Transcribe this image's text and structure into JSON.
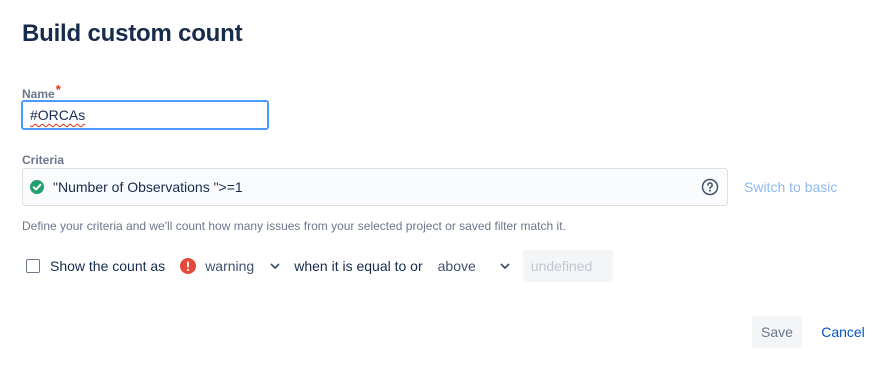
{
  "dialog": {
    "title": "Build custom count"
  },
  "name_field": {
    "label": "Name",
    "required_mark": "*",
    "value": "#ORCAs"
  },
  "criteria_field": {
    "label": "Criteria",
    "value": "\"Number of Observations \">=1",
    "status_icon": "check-circle-icon",
    "help_icon": "question-circle-icon",
    "switch_label": "Switch to basic",
    "helper_text": "Define your criteria and we'll count how many issues from your selected project or saved filter match it."
  },
  "count_row": {
    "checkbox_label": "Show the count as",
    "checked": false,
    "status_value": "warning",
    "connector_text": "when it is equal to or",
    "comparison_value": "above",
    "threshold_placeholder": "undefined"
  },
  "actions": {
    "save_label": "Save",
    "cancel_label": "Cancel"
  },
  "colors": {
    "accent": "#0052cc",
    "focus": "#4c9aff",
    "success": "#36b37e",
    "warning": "#ff5630",
    "link_disabled": "#8fb8ed"
  }
}
